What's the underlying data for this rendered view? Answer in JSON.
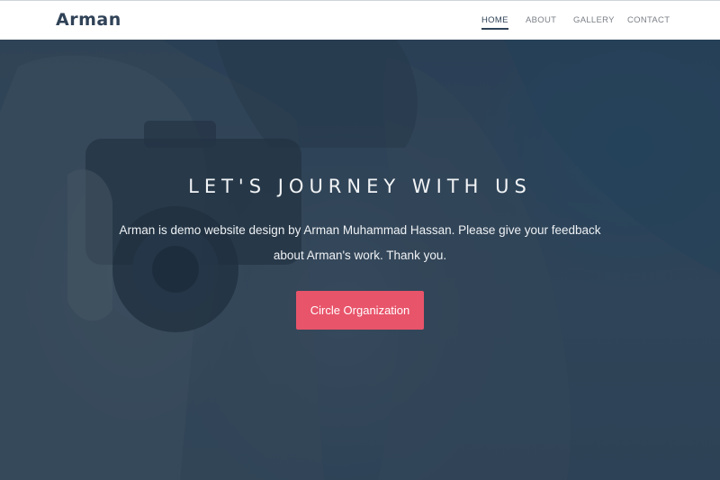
{
  "header": {
    "brand": "Arman",
    "nav": [
      {
        "label": "HOME",
        "active": true
      },
      {
        "label": "ABOUT",
        "active": false
      },
      {
        "label": "GALLERY",
        "active": false
      },
      {
        "label": "CONTACT",
        "active": false
      }
    ]
  },
  "hero": {
    "title": "LET'S JOURNEY WITH US",
    "subtitle": "Arman is demo website design by Arman Muhammad Hassan. Please give your feedback about Arman's work. Thank you.",
    "button_label": "Circle Organization",
    "background_image": "person-with-camera-icon"
  },
  "colors": {
    "brand": "#2f4257",
    "accent": "#e8546a",
    "overlay": "#2e4258",
    "nav_text": "#7a7f86"
  }
}
